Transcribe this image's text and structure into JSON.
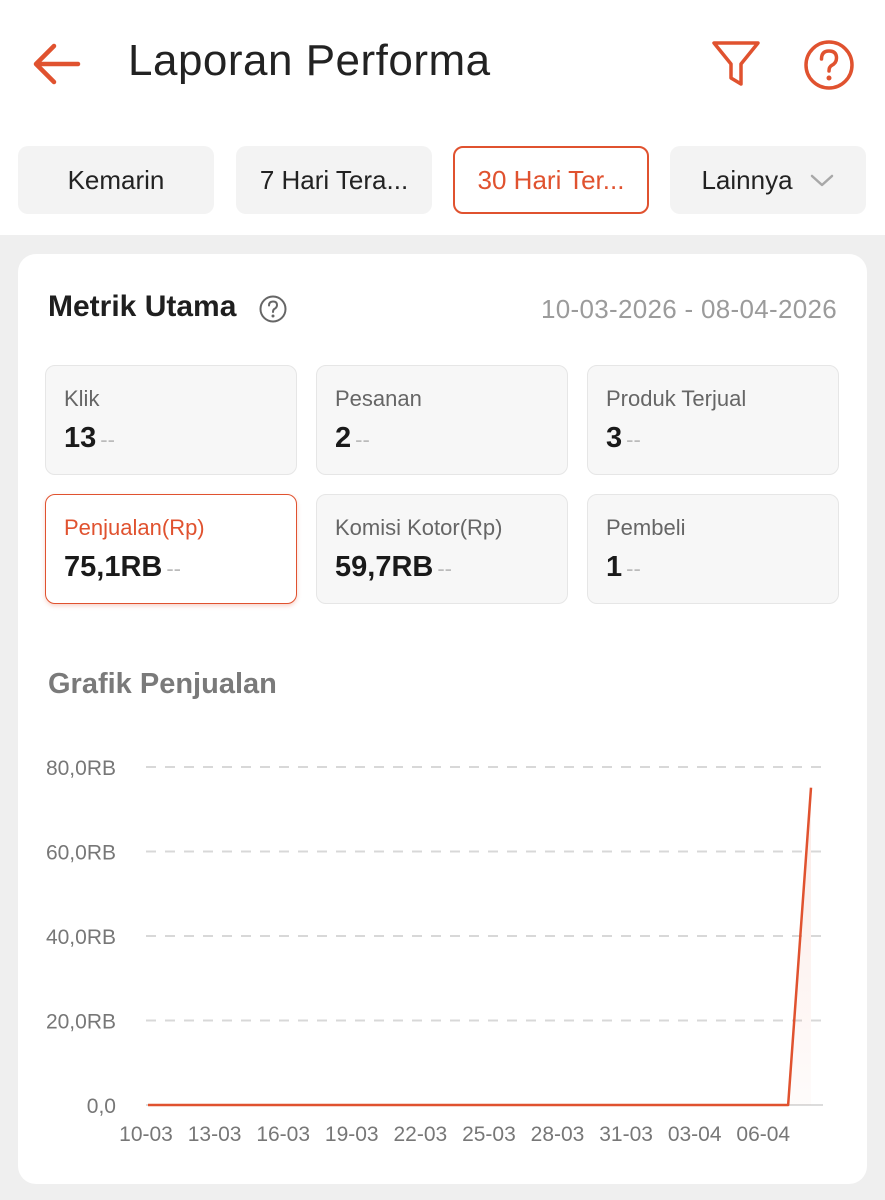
{
  "header": {
    "title": "Laporan Performa",
    "back_icon": "arrow-left-icon",
    "filter_icon": "funnel-icon",
    "help_icon": "question-circle-icon",
    "accent_color": "#e0522f"
  },
  "tabs": [
    {
      "label": "Kemarin",
      "active": false
    },
    {
      "label": "7 Hari Tera...",
      "active": false
    },
    {
      "label": "30 Hari Ter...",
      "active": true
    },
    {
      "label": "Lainnya",
      "active": false,
      "icon": "chevron-down-icon"
    }
  ],
  "metrics": {
    "title": "Metrik Utama",
    "date_range": "10-03-2026 - 08-04-2026",
    "items": [
      {
        "label": "Klik",
        "value": "13",
        "change": "--",
        "active": false
      },
      {
        "label": "Pesanan",
        "value": "2",
        "change": "--",
        "active": false
      },
      {
        "label": "Produk Terjual",
        "value": "3",
        "change": "--",
        "active": false
      },
      {
        "label": "Penjualan(Rp)",
        "value": "75,1RB",
        "change": "--",
        "active": true
      },
      {
        "label": "Komisi Kotor(Rp)",
        "value": "59,7RB",
        "change": "--",
        "active": false
      },
      {
        "label": "Pembeli",
        "value": "1",
        "change": "--",
        "active": false
      }
    ]
  },
  "chart_data": {
    "type": "line",
    "title": "Grafik Penjualan",
    "xlabel": "",
    "ylabel": "",
    "y_tick_labels": [
      "0,0",
      "20,0RB",
      "40,0RB",
      "60,0RB",
      "80,0RB"
    ],
    "y_ticks": [
      0,
      20000,
      40000,
      60000,
      80000
    ],
    "ylim": [
      0,
      80000
    ],
    "x_tick_labels": [
      "10-03",
      "13-03",
      "16-03",
      "19-03",
      "22-03",
      "25-03",
      "28-03",
      "31-03",
      "03-04",
      "06-04"
    ],
    "x": [
      "10-03",
      "11-03",
      "12-03",
      "13-03",
      "14-03",
      "15-03",
      "16-03",
      "17-03",
      "18-03",
      "19-03",
      "20-03",
      "21-03",
      "22-03",
      "23-03",
      "24-03",
      "25-03",
      "26-03",
      "27-03",
      "28-03",
      "29-03",
      "30-03",
      "31-03",
      "01-04",
      "02-04",
      "03-04",
      "04-04",
      "05-04",
      "06-04",
      "07-04",
      "08-04"
    ],
    "series": [
      {
        "values": [
          0,
          0,
          0,
          0,
          0,
          0,
          0,
          0,
          0,
          0,
          0,
          0,
          0,
          0,
          0,
          0,
          0,
          0,
          0,
          0,
          0,
          0,
          0,
          0,
          0,
          0,
          0,
          0,
          0,
          75100
        ],
        "color": "#e0522f"
      }
    ],
    "grid": true,
    "grid_style": "dashed horizontal"
  }
}
